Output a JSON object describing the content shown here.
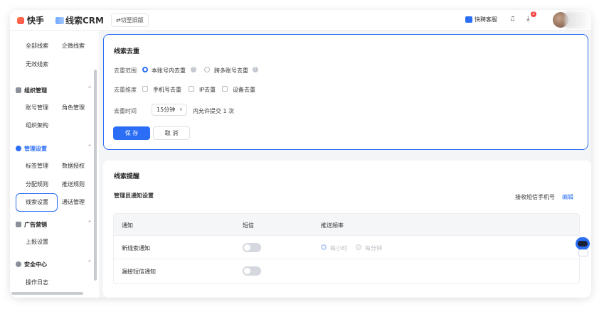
{
  "topbar": {
    "logo_text": "快手",
    "crm_text": "线索CRM",
    "switch_old": "⇄切至旧版",
    "service_label": "快聘客服",
    "notify_badge": "2"
  },
  "sidebar": {
    "row1": [
      "全部线索",
      "企微线索"
    ],
    "row2": [
      "无效线索"
    ],
    "group_org": "组织管理",
    "org_items": [
      "账号管理",
      "角色管理"
    ],
    "org_item2": "组织架构",
    "group_manage": "管理设置",
    "manage_row1": [
      "标签管理",
      "数据授权"
    ],
    "manage_row2": [
      "分配规则",
      "推送规则"
    ],
    "manage_row3": [
      "线索设置",
      "通话管理"
    ],
    "group_ads": "广告营销",
    "ads_item": "上报设置",
    "group_security": "安全中心",
    "security_item": "操作日志"
  },
  "dedup": {
    "title": "线索去重",
    "range_label": "去重范围",
    "range_opt1": "本账号内去重",
    "range_opt2": "跨多账号去重",
    "dim_label": "去重维度",
    "dim_opt1": "手机号去重",
    "dim_opt2": "IP去重",
    "dim_opt3": "设备去重",
    "time_label": "去重时间",
    "time_value": "15分钟",
    "time_suffix": "内允许提交 1 次",
    "save": "保 存",
    "cancel": "取 消"
  },
  "remind": {
    "title": "线索提醒",
    "admin_label": "管理员通知设置",
    "receive_label": "接收短信手机号",
    "edit": "编辑",
    "columns": [
      "通知",
      "短信",
      "推送频率"
    ],
    "rows": [
      {
        "name": "新线索通知",
        "freq1": "每小时",
        "freq2": "每分钟"
      },
      {
        "name": "漏接短信通知"
      }
    ]
  },
  "colors": {
    "accent": "#2b6ef5"
  }
}
